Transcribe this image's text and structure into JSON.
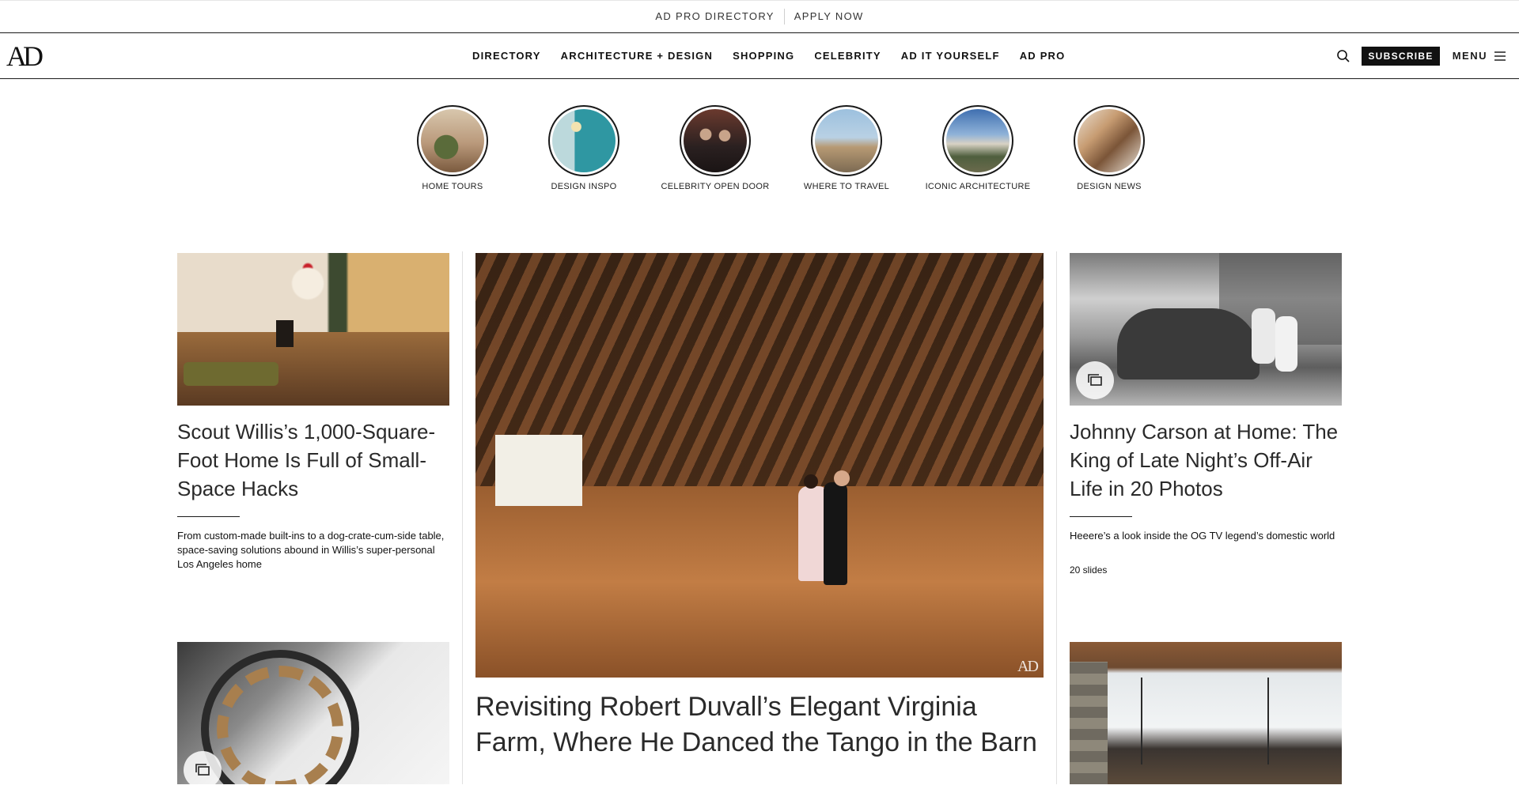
{
  "topbar": {
    "links": [
      "AD PRO DIRECTORY",
      "APPLY NOW"
    ]
  },
  "header": {
    "logo": "AD",
    "nav": [
      "DIRECTORY",
      "ARCHITECTURE + DESIGN",
      "SHOPPING",
      "CELEBRITY",
      "AD IT YOURSELF",
      "AD PRO"
    ],
    "subscribe_label": "SUBSCRIBE",
    "menu_label": "MENU"
  },
  "categories": [
    {
      "label": "HOME TOURS",
      "icon": "home-tours-thumbnail",
      "color": "#8a6a4a"
    },
    {
      "label": "DESIGN INSPO",
      "icon": "design-inspo-thumbnail",
      "color": "#3c9aa6"
    },
    {
      "label": "CELEBRITY OPEN DOOR",
      "icon": "celebrity-thumbnail",
      "color": "#3a3030"
    },
    {
      "label": "WHERE TO TRAVEL",
      "icon": "travel-thumbnail",
      "color": "#7aa3c8"
    },
    {
      "label": "ICONIC ARCHITECTURE",
      "icon": "architecture-thumbnail",
      "color": "#5b7da3"
    },
    {
      "label": "DESIGN NEWS",
      "icon": "design-news-thumbnail",
      "color": "#9a7a62"
    }
  ],
  "stories": {
    "left": {
      "title": "Scout Willis’s 1,000-Square-Foot Home Is Full of Small-Space Hacks",
      "dek": "From custom-made built-ins to a dog-crate-cum-side table, space-saving solutions abound in Willis’s super-personal Los Angeles home"
    },
    "center": {
      "title": "Revisiting Robert Duvall’s Elegant Virginia Farm, Where He Danced the Tango in the Barn",
      "watermark": "AD"
    },
    "right": {
      "title": "Johnny Carson at Home: The King of Late Night’s Off-Air Life in 20 Photos",
      "dek": "Heeere’s a look inside the OG TV legend’s domestic world",
      "slides": "20 slides"
    }
  },
  "colors": {
    "accent": "#1a1a1a",
    "subscribe_bg": "#111111"
  }
}
